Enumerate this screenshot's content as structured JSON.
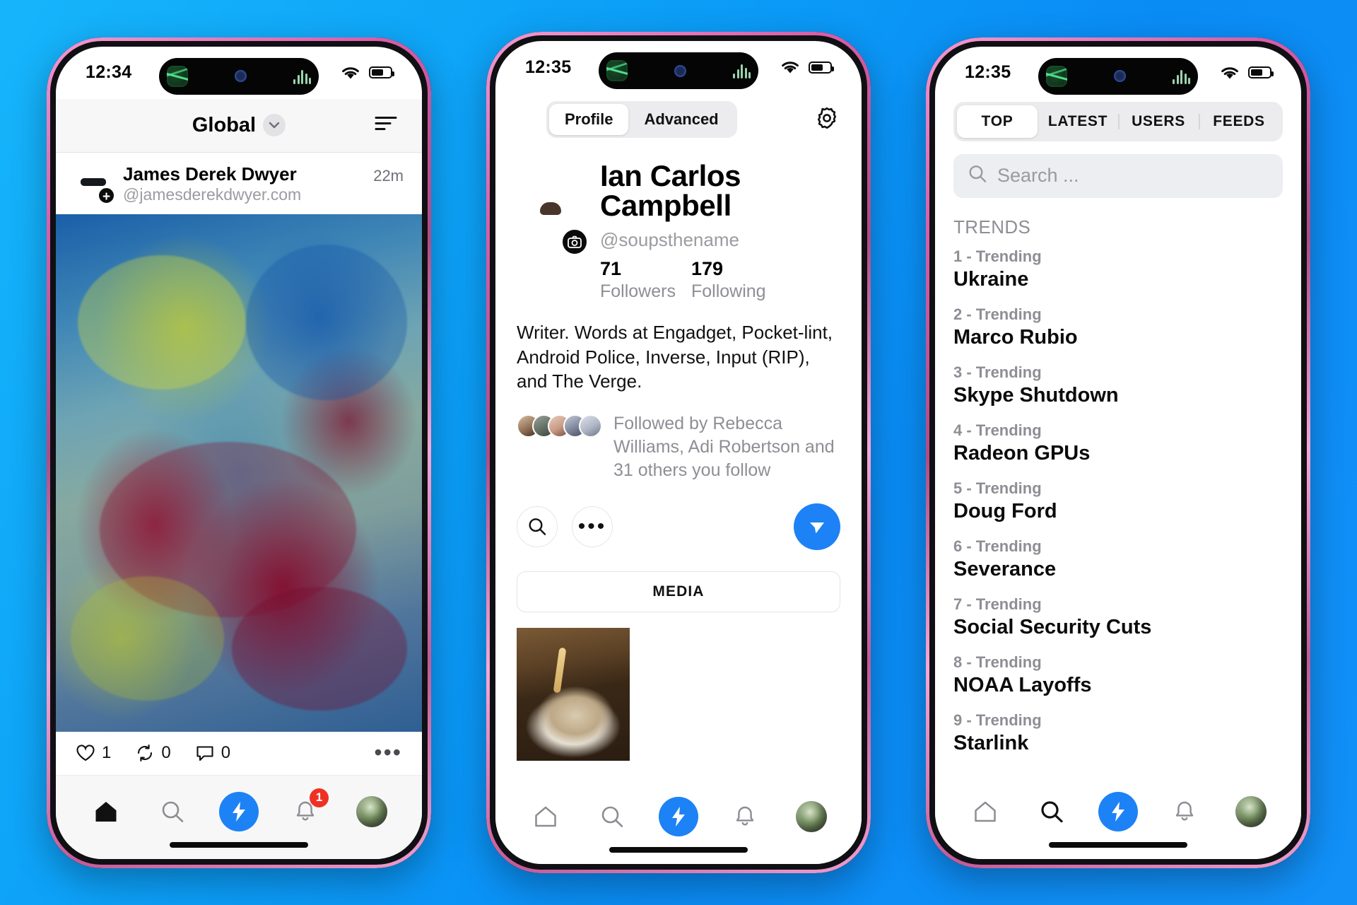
{
  "accent": {
    "blue": "#1d82f5",
    "badge_red": "#ef3124",
    "background": "#0b9df7"
  },
  "phone1": {
    "status": {
      "time": "12:34"
    },
    "header": {
      "title": "Global",
      "chevron_icon": "chevron-down-icon",
      "filter_icon": "filter-icon"
    },
    "post": {
      "author_name": "James Derek Dwyer",
      "author_handle": "@jamesderekdwyer.com",
      "timestamp": "22m",
      "avatar_badge": "+",
      "like_count": "1",
      "repost_count": "0",
      "reply_count": "0",
      "more_icon": "more-horizontal-icon"
    },
    "nav": {
      "home_icon": "home-icon",
      "search_icon": "search-icon",
      "compose_icon": "lightning-bolt-icon",
      "bell_icon": "bell-icon",
      "bell_badge": "1",
      "avatar_icon": "avatar-icon"
    }
  },
  "phone2": {
    "status": {
      "time": "12:35"
    },
    "segments": [
      {
        "label": "Profile",
        "selected": true
      },
      {
        "label": "Advanced",
        "selected": false
      }
    ],
    "settings_icon": "gear-icon",
    "profile": {
      "name": "Ian Carlos Campbell",
      "handle": "@soupsthename",
      "camera_icon": "camera-icon",
      "followers_count": "71",
      "followers_label": "Followers",
      "following_count": "179",
      "following_label": "Following",
      "bio": "Writer. Words at Engadget, Pocket-lint, Android Police, Inverse, Input (RIP), and The Verge.",
      "followed_by": "Followed by Rebecca Williams, Adi Robertson and 31 others you follow",
      "search_icon": "search-icon",
      "more_icon": "more-horizontal-icon",
      "message_icon": "send-icon",
      "media_label": "MEDIA"
    },
    "nav": {
      "home_icon": "home-icon",
      "search_icon": "search-icon",
      "compose_icon": "lightning-bolt-icon",
      "bell_icon": "bell-icon",
      "avatar_icon": "avatar-icon"
    }
  },
  "phone3": {
    "status": {
      "time": "12:35"
    },
    "tabs": [
      {
        "label": "TOP",
        "selected": true
      },
      {
        "label": "LATEST",
        "selected": false
      },
      {
        "label": "USERS",
        "selected": false
      },
      {
        "label": "FEEDS",
        "selected": false
      }
    ],
    "search": {
      "placeholder": "Search ...",
      "icon": "search-icon"
    },
    "trends_label": "TRENDS",
    "trends": [
      {
        "rank": "1 - Trending",
        "name": "Ukraine"
      },
      {
        "rank": "2 - Trending",
        "name": "Marco Rubio"
      },
      {
        "rank": "3 - Trending",
        "name": "Skype Shutdown"
      },
      {
        "rank": "4 - Trending",
        "name": "Radeon GPUs"
      },
      {
        "rank": "5 - Trending",
        "name": "Doug Ford"
      },
      {
        "rank": "6 - Trending",
        "name": "Severance"
      },
      {
        "rank": "7 - Trending",
        "name": "Social Security Cuts"
      },
      {
        "rank": "8 - Trending",
        "name": "NOAA Layoffs"
      },
      {
        "rank": "9 - Trending",
        "name": "Starlink"
      }
    ],
    "nav": {
      "home_icon": "home-icon",
      "search_icon": "search-icon",
      "compose_icon": "lightning-bolt-icon",
      "bell_icon": "bell-icon",
      "avatar_icon": "avatar-icon"
    }
  }
}
